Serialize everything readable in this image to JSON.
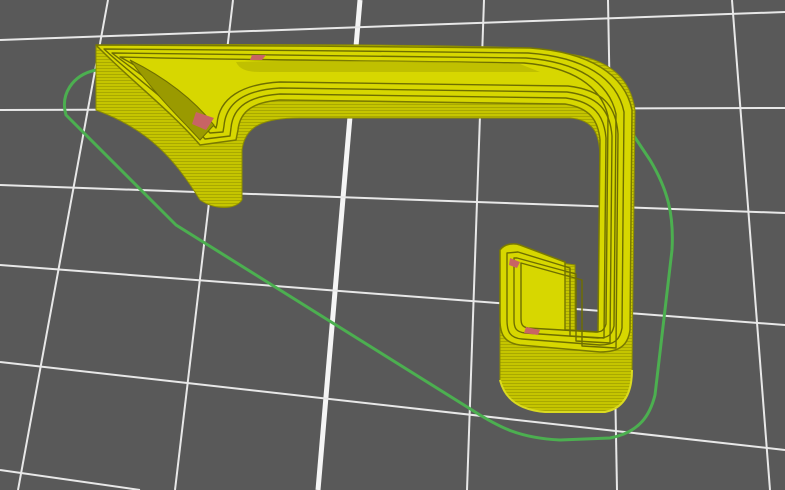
{
  "viewport": {
    "background": "#595959",
    "grid_color": "#e6e6e6",
    "grid_major_color": "#f4f4f4"
  },
  "model": {
    "wall_color": "#c8c800",
    "top_color": "#e4e400",
    "perimeter_dark": "#7a7a00",
    "gap_infill_color": "#c86464",
    "skirt_color": "#4caf50"
  }
}
